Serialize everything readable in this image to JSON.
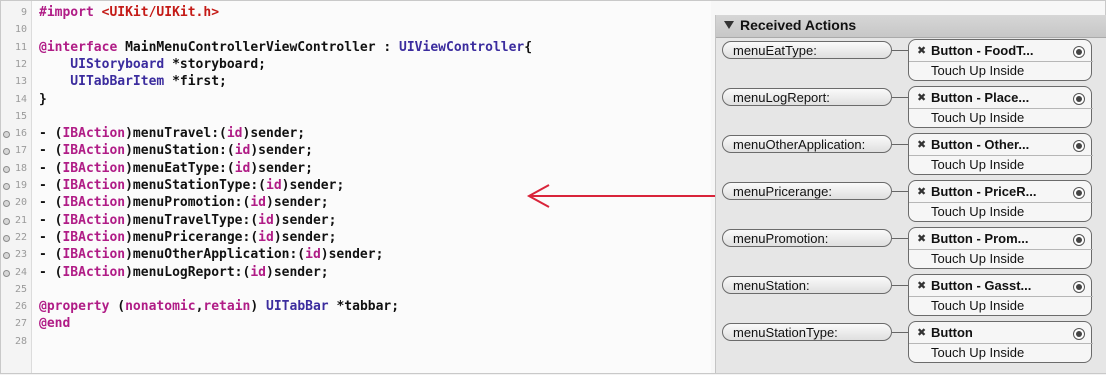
{
  "code": {
    "lines": [
      {
        "no": "9",
        "marker": false,
        "segments": [
          {
            "t": "#import ",
            "c": "kw"
          },
          {
            "t": "<UIKit/UIKit.h>",
            "c": "st"
          }
        ]
      },
      {
        "no": "10",
        "marker": false,
        "segments": []
      },
      {
        "no": "11",
        "marker": false,
        "segments": [
          {
            "t": "@interface ",
            "c": "kw"
          },
          {
            "t": "MainMenuControllerViewController",
            "c": "dk"
          },
          {
            "t": " : ",
            "c": "dk"
          },
          {
            "t": "UIViewController",
            "c": "ty"
          },
          {
            "t": "{",
            "c": "dk"
          }
        ]
      },
      {
        "no": "12",
        "marker": false,
        "segments": [
          {
            "t": "    UIStoryboard ",
            "c": "ty"
          },
          {
            "t": "*storyboard;",
            "c": "dk"
          }
        ]
      },
      {
        "no": "13",
        "marker": false,
        "segments": [
          {
            "t": "    UITabBarItem ",
            "c": "ty"
          },
          {
            "t": "*first;",
            "c": "dk"
          }
        ]
      },
      {
        "no": "14",
        "marker": false,
        "segments": [
          {
            "t": "}",
            "c": "dk"
          }
        ]
      },
      {
        "no": "15",
        "marker": false,
        "segments": []
      },
      {
        "no": "16",
        "marker": true,
        "segments": [
          {
            "t": "- (",
            "c": "dk"
          },
          {
            "t": "IBAction",
            "c": "kw"
          },
          {
            "t": ")menuTravel:(",
            "c": "dk"
          },
          {
            "t": "id",
            "c": "kw"
          },
          {
            "t": ")sender;",
            "c": "dk"
          }
        ]
      },
      {
        "no": "17",
        "marker": true,
        "segments": [
          {
            "t": "- (",
            "c": "dk"
          },
          {
            "t": "IBAction",
            "c": "kw"
          },
          {
            "t": ")menuStation:(",
            "c": "dk"
          },
          {
            "t": "id",
            "c": "kw"
          },
          {
            "t": ")sender;",
            "c": "dk"
          }
        ]
      },
      {
        "no": "18",
        "marker": true,
        "segments": [
          {
            "t": "- (",
            "c": "dk"
          },
          {
            "t": "IBAction",
            "c": "kw"
          },
          {
            "t": ")menuEatType:(",
            "c": "dk"
          },
          {
            "t": "id",
            "c": "kw"
          },
          {
            "t": ")sender;",
            "c": "dk"
          }
        ]
      },
      {
        "no": "19",
        "marker": true,
        "segments": [
          {
            "t": "- (",
            "c": "dk"
          },
          {
            "t": "IBAction",
            "c": "kw"
          },
          {
            "t": ")menuStationType:(",
            "c": "dk"
          },
          {
            "t": "id",
            "c": "kw"
          },
          {
            "t": ")sender;",
            "c": "dk"
          }
        ]
      },
      {
        "no": "20",
        "marker": true,
        "segments": [
          {
            "t": "- (",
            "c": "dk"
          },
          {
            "t": "IBAction",
            "c": "kw"
          },
          {
            "t": ")menuPromotion:(",
            "c": "dk"
          },
          {
            "t": "id",
            "c": "kw"
          },
          {
            "t": ")sender;",
            "c": "dk"
          }
        ]
      },
      {
        "no": "21",
        "marker": true,
        "segments": [
          {
            "t": "- (",
            "c": "dk"
          },
          {
            "t": "IBAction",
            "c": "kw"
          },
          {
            "t": ")menuTravelType:(",
            "c": "dk"
          },
          {
            "t": "id",
            "c": "kw"
          },
          {
            "t": ")sender;",
            "c": "dk"
          }
        ]
      },
      {
        "no": "22",
        "marker": true,
        "segments": [
          {
            "t": "- (",
            "c": "dk"
          },
          {
            "t": "IBAction",
            "c": "kw"
          },
          {
            "t": ")menuPricerange:(",
            "c": "dk"
          },
          {
            "t": "id",
            "c": "kw"
          },
          {
            "t": ")sender;",
            "c": "dk"
          }
        ]
      },
      {
        "no": "23",
        "marker": true,
        "segments": [
          {
            "t": "- (",
            "c": "dk"
          },
          {
            "t": "IBAction",
            "c": "kw"
          },
          {
            "t": ")menuOtherApplication:(",
            "c": "dk"
          },
          {
            "t": "id",
            "c": "kw"
          },
          {
            "t": ")sender;",
            "c": "dk"
          }
        ]
      },
      {
        "no": "24",
        "marker": true,
        "segments": [
          {
            "t": "- (",
            "c": "dk"
          },
          {
            "t": "IBAction",
            "c": "kw"
          },
          {
            "t": ")menuLogReport:(",
            "c": "dk"
          },
          {
            "t": "id",
            "c": "kw"
          },
          {
            "t": ")sender;",
            "c": "dk"
          }
        ]
      },
      {
        "no": "25",
        "marker": false,
        "segments": []
      },
      {
        "no": "26",
        "marker": false,
        "segments": [
          {
            "t": "@property ",
            "c": "kw"
          },
          {
            "t": "(",
            "c": "dk"
          },
          {
            "t": "nonatomic",
            "c": "kw"
          },
          {
            "t": ",",
            "c": "dk"
          },
          {
            "t": "retain",
            "c": "kw"
          },
          {
            "t": ") ",
            "c": "dk"
          },
          {
            "t": "UITabBar",
            "c": "ty"
          },
          {
            "t": " *tabbar;",
            "c": "dk"
          }
        ]
      },
      {
        "no": "27",
        "marker": false,
        "segments": [
          {
            "t": "@end",
            "c": "kw"
          }
        ]
      },
      {
        "no": "28",
        "marker": false,
        "segments": []
      }
    ]
  },
  "panel": {
    "title": "Received Actions",
    "actions": [
      {
        "action": "menuEatType:",
        "target": "Button - FoodT...",
        "event": "Touch Up Inside"
      },
      {
        "action": "menuLogReport:",
        "target": "Button - Place...",
        "event": "Touch Up Inside"
      },
      {
        "action": "menuOtherApplication:",
        "target": "Button - Other...",
        "event": "Touch Up Inside"
      },
      {
        "action": "menuPricerange:",
        "target": "Button - PriceR...",
        "event": "Touch Up Inside"
      },
      {
        "action": "menuPromotion:",
        "target": "Button - Prom...",
        "event": "Touch Up Inside"
      },
      {
        "action": "menuStation:",
        "target": "Button - Gasst...",
        "event": "Touch Up Inside"
      },
      {
        "action": "menuStationType:",
        "target": "Button",
        "event": "Touch Up Inside"
      }
    ]
  },
  "colors": {
    "arrow": "#d9243a",
    "keyword": "#b01c86",
    "type": "#3b2c9e",
    "string": "#c41a16"
  },
  "icons": {
    "collapse": "disclosure-triangle-icon",
    "remove": "remove-x-icon",
    "connection": "connection-circle-icon",
    "marker": "breakpoint-dot-icon"
  }
}
